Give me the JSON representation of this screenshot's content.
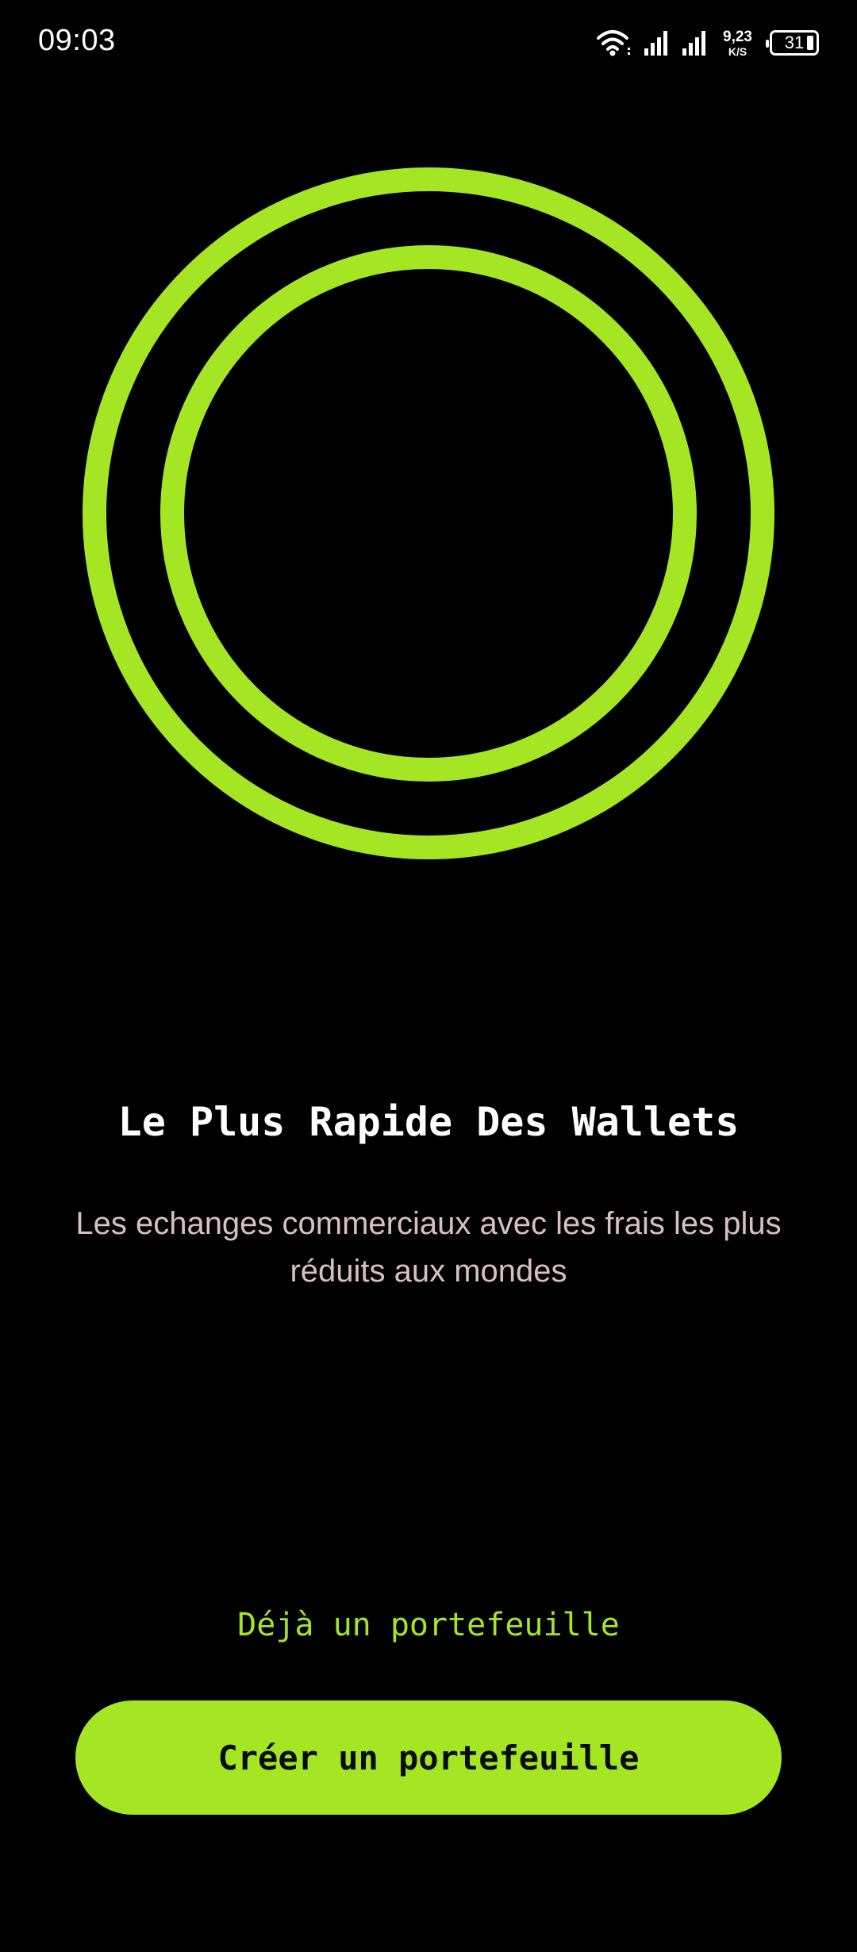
{
  "status_bar": {
    "time": "09:03",
    "net_speed_value": "9,23",
    "net_speed_unit": "K/S",
    "battery_level": "31",
    "icons": [
      "wifi-icon",
      "signal-icon",
      "signal-icon",
      "battery-icon"
    ]
  },
  "colors": {
    "accent": "#a4e524",
    "background": "#000000",
    "subtitle": "#d9c0c0"
  },
  "logo": {
    "icon": "double-ring-logo-icon"
  },
  "onboarding": {
    "title": "Le Plus Rapide Des Wallets",
    "subtitle": "Les echanges commerciaux avec les frais les plus réduits aux mondes"
  },
  "actions": {
    "existing_wallet_label": "Déjà un portefeuille",
    "create_wallet_label": "Créer un portefeuille"
  }
}
